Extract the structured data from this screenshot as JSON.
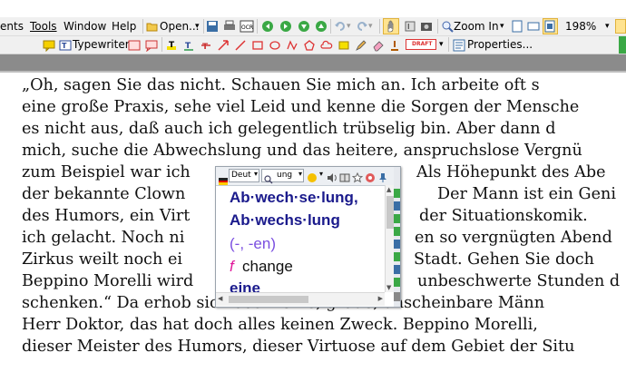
{
  "menubar": {
    "items": [
      "ents",
      "Tools",
      "Window",
      "Help"
    ],
    "open_label": "Open...",
    "zoom_in_label": "Zoom In",
    "zoom_value": "198%"
  },
  "toolbar2": {
    "typewriter_label": "Typewriter",
    "stamp_label": "DRAFT",
    "properties_label": "Properties..."
  },
  "document": {
    "lines": [
      "„Oh, sagen Sie das nicht.  Schauen Sie mich an.  Ich arbeite oft s",
      "eine große Praxis, sehe viel Leid und kenne die Sorgen der Mensche",
      "es nicht aus, daß auch ich gelegentlich trübselig bin.  Aber dann d",
      "mich, suche die Abwechslung und das heitere, anspruchslose Vergnü",
      "zum Beispiel war ich",
      "der bekannte Clown",
      "des Humors, ein Virt",
      "ich gelacht.  Noch ni",
      "Zirkus weilt  noch ei",
      "Beppino Morelli wird",
      "schenken.“  Da erhob sich das kleine, graue, unscheinbare Männ",
      "Herr Doktor, das hat doch alles keinen Zweck.  Beppino Morelli,",
      "dieser Meister des Humors, dieser Virtuose auf dem Gebiet der Situ"
    ],
    "right_fragments": [
      "Als Höhepunkt des Abe",
      "Der Mann ist ein Geni",
      "der Situationskomik.",
      "en so vergnügten Abend",
      "Stadt.   Gehen Sie doch",
      "unbeschwerte Stunden d"
    ]
  },
  "popup": {
    "language": "Deut",
    "search_value": "ung",
    "entries": {
      "headword1": "Ab·wech·se·lung,",
      "headword2": "Ab·wechs·lung",
      "grammar": "(-, -en)",
      "pos": "f",
      "translation": "change",
      "next": "eine"
    },
    "colors": {
      "headword": "#1a1a8c",
      "grammar": "#7b4fe0",
      "pos": "#e0189a",
      "translation": "#111111"
    }
  }
}
